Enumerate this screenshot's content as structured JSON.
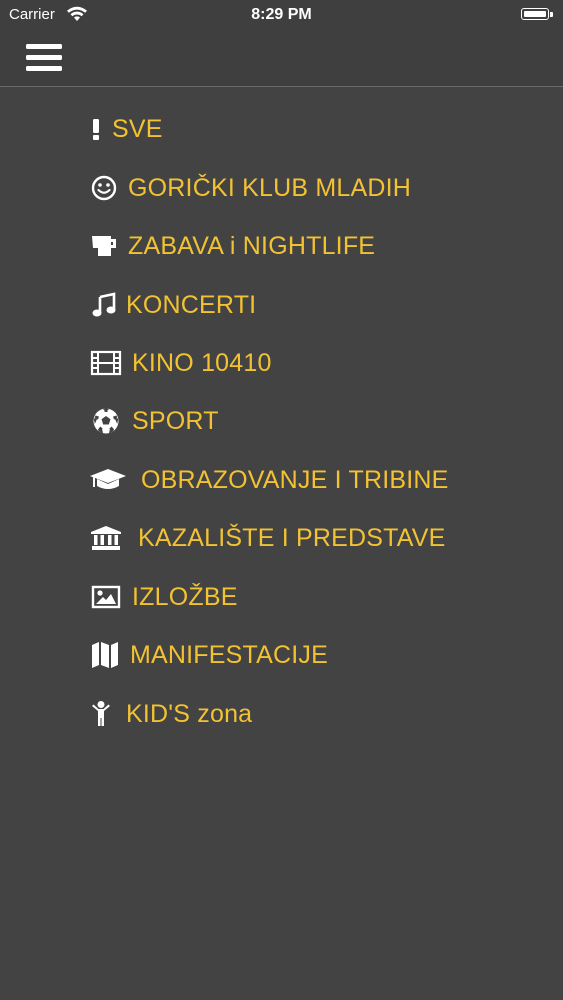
{
  "status_bar": {
    "carrier": "Carrier",
    "time": "8:29 PM"
  },
  "nav": {
    "menu_icon": "hamburger-menu-icon"
  },
  "menu": {
    "items": [
      {
        "label": "SVE",
        "icon": "exclamation-icon"
      },
      {
        "label": "GORIČKI KLUB MLADIH",
        "icon": "smiley-icon"
      },
      {
        "label": "ZABAVA i NIGHTLIFE",
        "icon": "glass-icon"
      },
      {
        "label": "KONCERTI",
        "icon": "music-note-icon"
      },
      {
        "label": "KINO 10410",
        "icon": "film-icon"
      },
      {
        "label": "SPORT",
        "icon": "soccer-ball-icon"
      },
      {
        "label": "OBRAZOVANJE I TRIBINE",
        "icon": "graduation-cap-icon"
      },
      {
        "label": "KAZALIŠTE I PREDSTAVE",
        "icon": "theater-building-icon"
      },
      {
        "label": "IZLOŽBE",
        "icon": "picture-icon"
      },
      {
        "label": "MANIFESTACIJE",
        "icon": "map-icon"
      },
      {
        "label": "KID'S zona",
        "icon": "child-icon"
      }
    ]
  },
  "colors": {
    "background": "#434343",
    "accent": "#f2c233",
    "icon": "#ffffff"
  }
}
